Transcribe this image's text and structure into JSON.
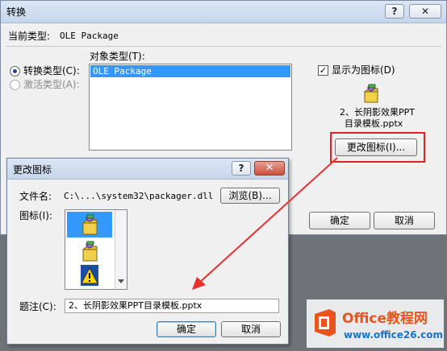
{
  "convert_dialog": {
    "title": "转换",
    "help_glyph": "?",
    "close_glyph": "✕",
    "current_type_label": "当前类型:",
    "current_type_value": "OLE Package",
    "object_type_label": "对象类型(T):",
    "radio_convert": "转换类型(C):",
    "radio_activate": "激活类型(A):",
    "object_types": [
      "OLE Package"
    ],
    "show_as_icon_label": "显示为图标(D)",
    "show_as_icon_checked": true,
    "icon_caption_line1": "2、长阴影效果PPT",
    "icon_caption_line2": "目录模板.pptx",
    "change_icon_button": "更改图标(I)...",
    "ok_button": "确定",
    "cancel_button": "取消"
  },
  "change_icon_dialog": {
    "title": "更改图标",
    "help_glyph": "?",
    "close_glyph": "✕",
    "file_label": "文件名:",
    "file_value": "C:\\...\\system32\\packager.dll",
    "browse_button": "浏览(B)...",
    "icon_label": "图标(I):",
    "caption_label": "题注(C):",
    "caption_value": "2、长阴影效果PPT目录模板.pptx",
    "ok_button": "确定",
    "cancel_button": "取消"
  },
  "watermark": {
    "brand": "Office教程网",
    "url": "www.office26.com"
  },
  "colors": {
    "highlight_red": "#e02020",
    "logo_orange": "#e8541e",
    "brand_blue": "#1a73c6"
  }
}
